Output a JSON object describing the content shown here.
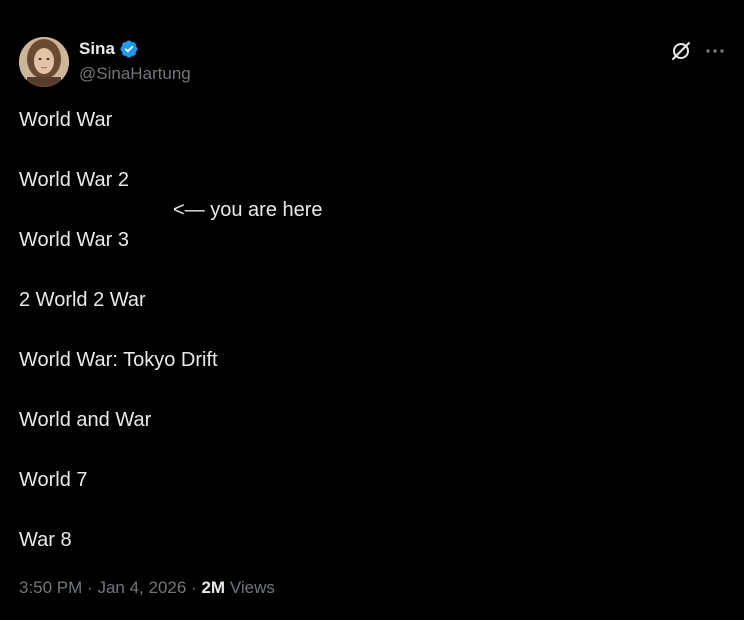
{
  "author": {
    "display_name": "Sina",
    "handle": "@SinaHartung",
    "verified_color": "#1d9bf0"
  },
  "header_icons": {
    "grok": "grok-icon",
    "more": "more-icon"
  },
  "post": {
    "lines": [
      "World War",
      "World War 2",
      "World War 3",
      "2 World 2 War",
      "World War: Tokyo Drift",
      "World and War",
      "World 7",
      "War 8"
    ],
    "annotation": "<— you are here"
  },
  "meta": {
    "time": "3:50 PM",
    "separator": "·",
    "date": "Jan 4, 2026",
    "views_count": "2M",
    "views_label": "Views"
  },
  "colors": {
    "background": "#000000",
    "text_primary": "#e7e9ea",
    "text_secondary": "#71767b",
    "accent": "#1d9bf0"
  }
}
